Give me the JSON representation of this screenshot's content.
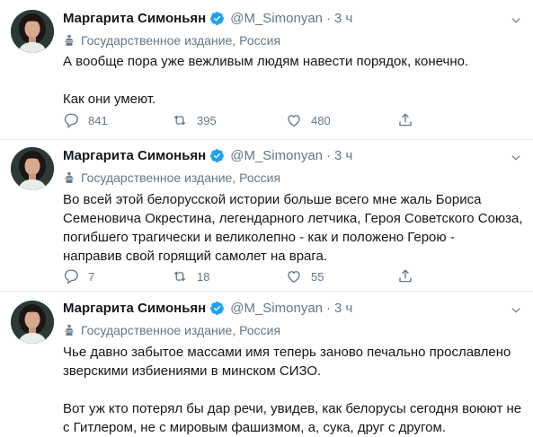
{
  "tweets": [
    {
      "author": "Маргарита Симоньян",
      "handle": "@M_Simonyan",
      "sep": "·",
      "time": "3 ч",
      "label": "Государственное издание, Россия",
      "text_lines": [
        "А вообще пора уже вежливым людям навести порядок, конечно.",
        "",
        "Как они умеют."
      ],
      "replies": "841",
      "retweets": "395",
      "likes": "480"
    },
    {
      "author": "Маргарита Симоньян",
      "handle": "@M_Simonyan",
      "sep": "·",
      "time": "3 ч",
      "label": "Государственное издание, Россия",
      "text_lines": [
        "Во всей этой белорусской истории больше всего мне жаль Бориса",
        "Семеновича Окрестина, легендарного летчика, Героя Советского Союза,",
        "погибшего трагически и великолепно - как и положено Герою -",
        "направив свой горящий самолет на врага."
      ],
      "replies": "7",
      "retweets": "18",
      "likes": "55"
    },
    {
      "author": "Маргарита Симоньян",
      "handle": "@M_Simonyan",
      "sep": "·",
      "time": "3 ч",
      "label": "Государственное издание, Россия",
      "text_lines": [
        "Чье давно забытое массами имя теперь заново печально прославлено",
        "зверскими избиениями в минском СИЗО.",
        "",
        "Вот уж кто потерял бы дар речи, увидев, как белорусы сегодня воюют не",
        "с Гитлером, не с мировым фашизмом, а, сука, друг с другом."
      ]
    }
  ],
  "icons": {
    "verified": "verified-badge-icon",
    "label": "state-media-podium-icon",
    "reply": "reply-icon",
    "retweet": "retweet-icon",
    "like": "like-icon",
    "share": "share-icon",
    "more": "chevron-down-icon"
  },
  "colors": {
    "verified": "#1da1f2",
    "secondary_text": "#657786",
    "divider": "#e6ecf0"
  }
}
